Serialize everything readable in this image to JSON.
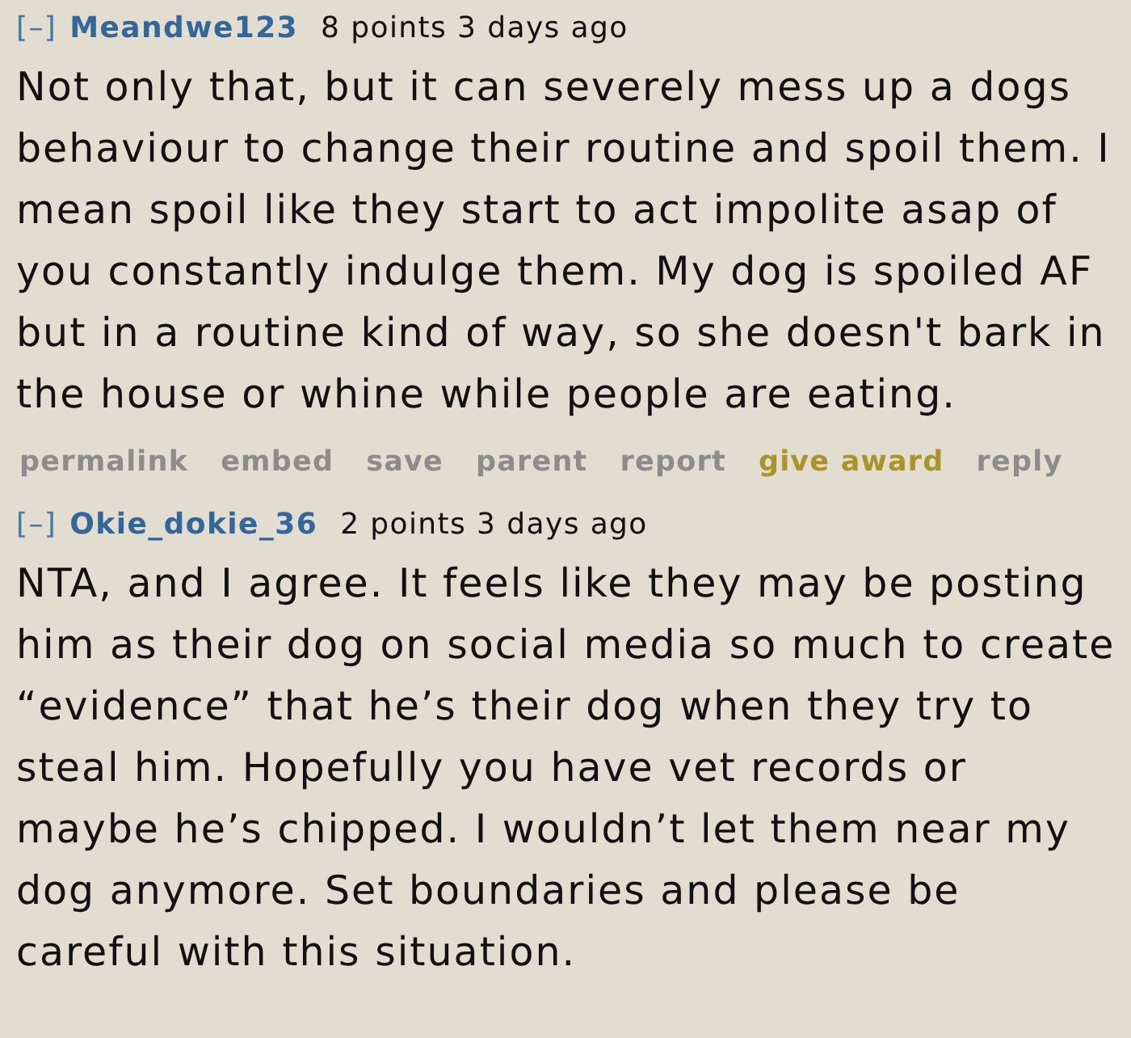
{
  "comments": [
    {
      "toggle": "[–]",
      "author": "Meandwe123",
      "points": "8 points",
      "age": "3 days ago",
      "body": "Not only that, but it can severely mess up a dogs behaviour to change their routine and spoil them. I mean spoil like they start to act impolite asap of you constantly indulge them. My dog is spoiled AF but in a routine kind of way, so she doesn't bark in the house or whine while people are eating.",
      "actions": [
        {
          "label": "permalink",
          "kind": "plain"
        },
        {
          "label": "embed",
          "kind": "plain"
        },
        {
          "label": "save",
          "kind": "plain"
        },
        {
          "label": "parent",
          "kind": "plain"
        },
        {
          "label": "report",
          "kind": "plain"
        },
        {
          "label": "give award",
          "kind": "award"
        },
        {
          "label": "reply",
          "kind": "plain"
        }
      ]
    },
    {
      "toggle": "[–]",
      "author": "Okie_dokie_36",
      "points": "2 points",
      "age": "3 days ago",
      "body": "NTA, and I agree. It feels like they may be posting him as their dog on social media so much to create “evidence” that he’s their dog when they try to steal him. Hopefully you have vet records or maybe he’s chipped. I wouldn’t let them near my dog anymore. Set boundaries and please be careful with this situation."
    }
  ]
}
